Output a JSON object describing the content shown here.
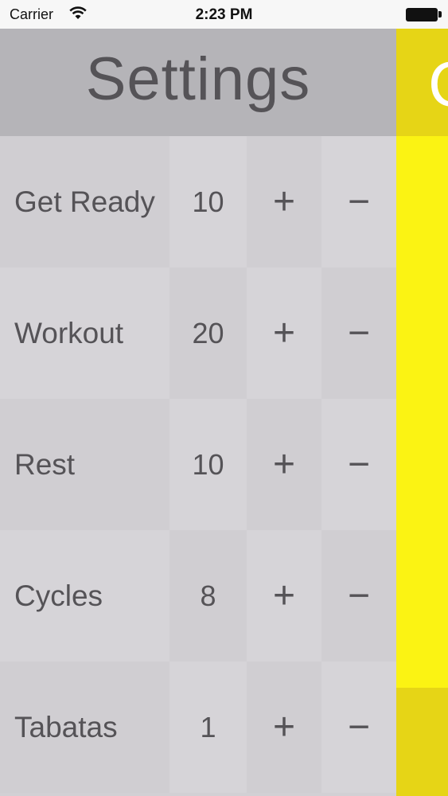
{
  "status_bar": {
    "carrier": "Carrier",
    "time": "2:23 PM",
    "wifi_icon": "wifi-icon",
    "battery_icon": "battery-icon"
  },
  "header": {
    "title": "Settings"
  },
  "rows": [
    {
      "label": "Get Ready",
      "value": "10",
      "plus": "+",
      "minus": "−"
    },
    {
      "label": "Workout",
      "value": "20",
      "plus": "+",
      "minus": "−"
    },
    {
      "label": "Rest",
      "value": "10",
      "plus": "+",
      "minus": "−"
    },
    {
      "label": "Cycles",
      "value": "8",
      "plus": "+",
      "minus": "−"
    },
    {
      "label": "Tabatas",
      "value": "1",
      "plus": "+",
      "minus": "−"
    }
  ],
  "side_panel": {
    "letter": "C"
  },
  "colors": {
    "accent_yellow": "#fbf313",
    "accent_yellow_dark": "#e6d516",
    "header_bg": "#b5b4b8",
    "text": "#555357"
  }
}
